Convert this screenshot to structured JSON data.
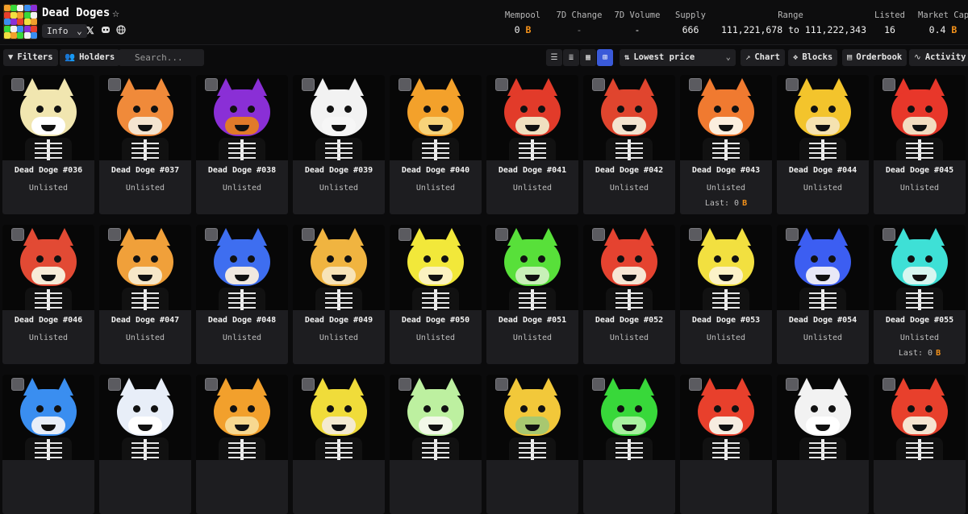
{
  "collection": {
    "title": "Dead Doges",
    "info_label": "Info",
    "icons": [
      "star-icon",
      "x-icon",
      "discord-icon",
      "globe-icon"
    ]
  },
  "stats": {
    "mempool": {
      "label": "Mempool",
      "value": "0"
    },
    "change7d": {
      "label": "7D Change",
      "value": "-"
    },
    "volume7d": {
      "label": "7D Volume",
      "value": "-"
    },
    "supply": {
      "label": "Supply",
      "value": "666"
    },
    "range": {
      "label": "Range",
      "value": "111,221,678 to 111,222,343"
    },
    "listed": {
      "label": "Listed",
      "value": "16"
    },
    "marketcap": {
      "label": "Market Cap",
      "value": "0.4"
    }
  },
  "btc_symbol": "B",
  "toolbar": {
    "filters": "Filters",
    "holders": "Holders",
    "search_placeholder": "Search...",
    "sort": "Lowest price",
    "chart": "Chart",
    "blocks": "Blocks",
    "orderbook": "Orderbook",
    "activity": "Activity"
  },
  "colors": {
    "btc": "#f7931a",
    "accent": "#3a5ad9"
  },
  "items": [
    {
      "name": "Dead Doge #036",
      "status": "Unlisted",
      "last": "",
      "head": "#f1e6b0",
      "muzzle": "#ffffff"
    },
    {
      "name": "Dead Doge #037",
      "status": "Unlisted",
      "last": "",
      "head": "#f08a3a",
      "muzzle": "#f4e4d0"
    },
    {
      "name": "Dead Doge #038",
      "status": "Unlisted",
      "last": "",
      "head": "#8a2fd6",
      "muzzle": "#e07a2a"
    },
    {
      "name": "Dead Doge #039",
      "status": "Unlisted",
      "last": "",
      "head": "#f2f2f2",
      "muzzle": "#f6f6f6"
    },
    {
      "name": "Dead Doge #040",
      "status": "Unlisted",
      "last": "",
      "head": "#f3a12b",
      "muzzle": "#f7d37a"
    },
    {
      "name": "Dead Doge #041",
      "status": "Unlisted",
      "last": "",
      "head": "#e23b2a",
      "muzzle": "#f0e0c0"
    },
    {
      "name": "Dead Doge #042",
      "status": "Unlisted",
      "last": "",
      "head": "#e0452e",
      "muzzle": "#f3e4d0"
    },
    {
      "name": "Dead Doge #043",
      "status": "Unlisted",
      "last": "Last: 0",
      "head": "#f07a30",
      "muzzle": "#fbeede"
    },
    {
      "name": "Dead Doge #044",
      "status": "Unlisted",
      "last": "",
      "head": "#f3c42c",
      "muzzle": "#f5e2b0"
    },
    {
      "name": "Dead Doge #045",
      "status": "Unlisted",
      "last": "",
      "head": "#e8372a",
      "muzzle": "#f2dcc0"
    },
    {
      "name": "Dead Doge #046",
      "status": "Unlisted",
      "last": "",
      "head": "#e24a34",
      "muzzle": "#f7ecd8"
    },
    {
      "name": "Dead Doge #047",
      "status": "Unlisted",
      "last": "",
      "head": "#f0a03a",
      "muzzle": "#f6e7c8"
    },
    {
      "name": "Dead Doge #048",
      "status": "Unlisted",
      "last": "",
      "head": "#3e6ef0",
      "muzzle": "#f0e8e0"
    },
    {
      "name": "Dead Doge #049",
      "status": "Unlisted",
      "last": "",
      "head": "#f0b440",
      "muzzle": "#f7e3b8"
    },
    {
      "name": "Dead Doge #050",
      "status": "Unlisted",
      "last": "",
      "head": "#f2e83a",
      "muzzle": "#fbf2c0"
    },
    {
      "name": "Dead Doge #051",
      "status": "Unlisted",
      "last": "",
      "head": "#58e03a",
      "muzzle": "#c8f0b8"
    },
    {
      "name": "Dead Doge #052",
      "status": "Unlisted",
      "last": "",
      "head": "#e54330",
      "muzzle": "#f6e6d4"
    },
    {
      "name": "Dead Doge #053",
      "status": "Unlisted",
      "last": "",
      "head": "#f2e040",
      "muzzle": "#fcf2c8"
    },
    {
      "name": "Dead Doge #054",
      "status": "Unlisted",
      "last": "",
      "head": "#3c5ef2",
      "muzzle": "#e8e8f6"
    },
    {
      "name": "Dead Doge #055",
      "status": "Unlisted",
      "last": "Last: 0",
      "head": "#3ee0d6",
      "muzzle": "#d6f6f0"
    },
    {
      "name": "",
      "status": "",
      "last": "",
      "head": "#3a8ef0",
      "muzzle": "#e8eef8"
    },
    {
      "name": "",
      "status": "",
      "last": "",
      "head": "#e8eef8",
      "muzzle": "#ffffff"
    },
    {
      "name": "",
      "status": "",
      "last": "",
      "head": "#f2a02c",
      "muzzle": "#f7d890"
    },
    {
      "name": "",
      "status": "",
      "last": "",
      "head": "#f0dc3a",
      "muzzle": "#f4ead0"
    },
    {
      "name": "",
      "status": "",
      "last": "",
      "head": "#bdf0a0",
      "muzzle": "#f2f8e8"
    },
    {
      "name": "",
      "status": "",
      "last": "",
      "head": "#f2c83a",
      "muzzle": "#a8c870"
    },
    {
      "name": "",
      "status": "",
      "last": "",
      "head": "#38d83a",
      "muzzle": "#a8f0a0"
    },
    {
      "name": "",
      "status": "",
      "last": "",
      "head": "#e8402c",
      "muzzle": "#f6ece0"
    },
    {
      "name": "",
      "status": "",
      "last": "",
      "head": "#f2f2f2",
      "muzzle": "#ffffff"
    },
    {
      "name": "",
      "status": "",
      "last": "",
      "head": "#e8402c",
      "muzzle": "#f6e4d0"
    }
  ]
}
